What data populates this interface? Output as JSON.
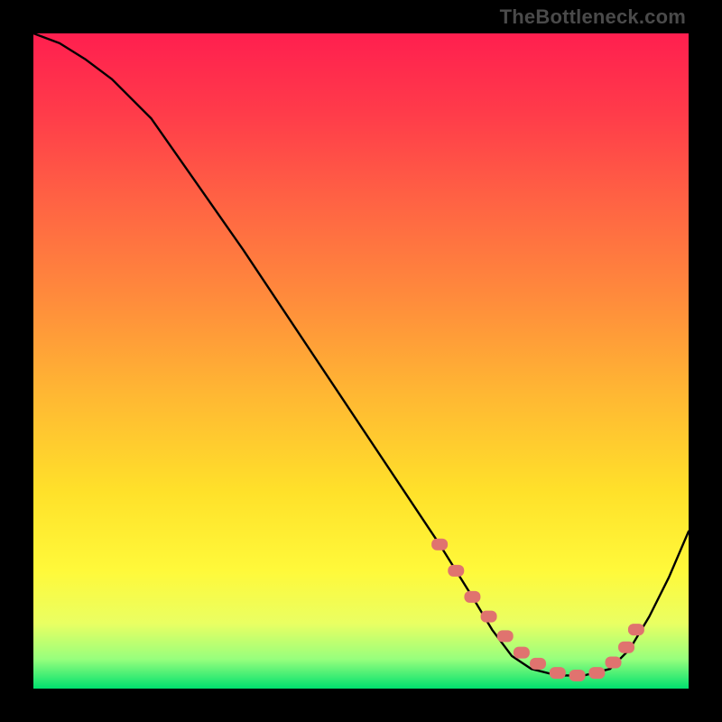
{
  "attribution": "TheBottleneck.com",
  "chart_data": {
    "type": "line",
    "title": "",
    "xlabel": "",
    "ylabel": "",
    "xlim": [
      0,
      100
    ],
    "ylim": [
      0,
      100
    ],
    "series": [
      {
        "name": "curve",
        "x": [
          0,
          4,
          8,
          12,
          18,
          25,
          32,
          40,
          48,
          56,
          62,
          67,
          70,
          73,
          76,
          80,
          84,
          88,
          91,
          94,
          97,
          100
        ],
        "y": [
          100,
          98.5,
          96,
          93,
          87,
          77,
          67,
          55,
          43,
          31,
          22,
          14,
          9,
          5,
          3,
          2,
          2,
          3,
          6,
          11,
          17,
          24
        ]
      }
    ],
    "markers": {
      "name": "highlighted-points",
      "x": [
        62,
        64.5,
        67,
        69.5,
        72,
        74.5,
        77,
        80,
        83,
        86,
        88.5,
        90.5,
        92
      ],
      "y": [
        22,
        18,
        14,
        11,
        8,
        5.5,
        3.8,
        2.4,
        2,
        2.4,
        4,
        6.3,
        9
      ]
    },
    "background_gradient": {
      "stops": [
        {
          "offset": 0.0,
          "color": "#ff1f4f"
        },
        {
          "offset": 0.12,
          "color": "#ff3b4a"
        },
        {
          "offset": 0.25,
          "color": "#ff6144"
        },
        {
          "offset": 0.4,
          "color": "#ff8a3c"
        },
        {
          "offset": 0.55,
          "color": "#ffb733"
        },
        {
          "offset": 0.7,
          "color": "#ffe12a"
        },
        {
          "offset": 0.82,
          "color": "#fff93a"
        },
        {
          "offset": 0.9,
          "color": "#eaff62"
        },
        {
          "offset": 0.955,
          "color": "#97ff7d"
        },
        {
          "offset": 1.0,
          "color": "#00e06e"
        }
      ]
    },
    "line_color": "#000000",
    "marker_color": "#e0736f"
  }
}
